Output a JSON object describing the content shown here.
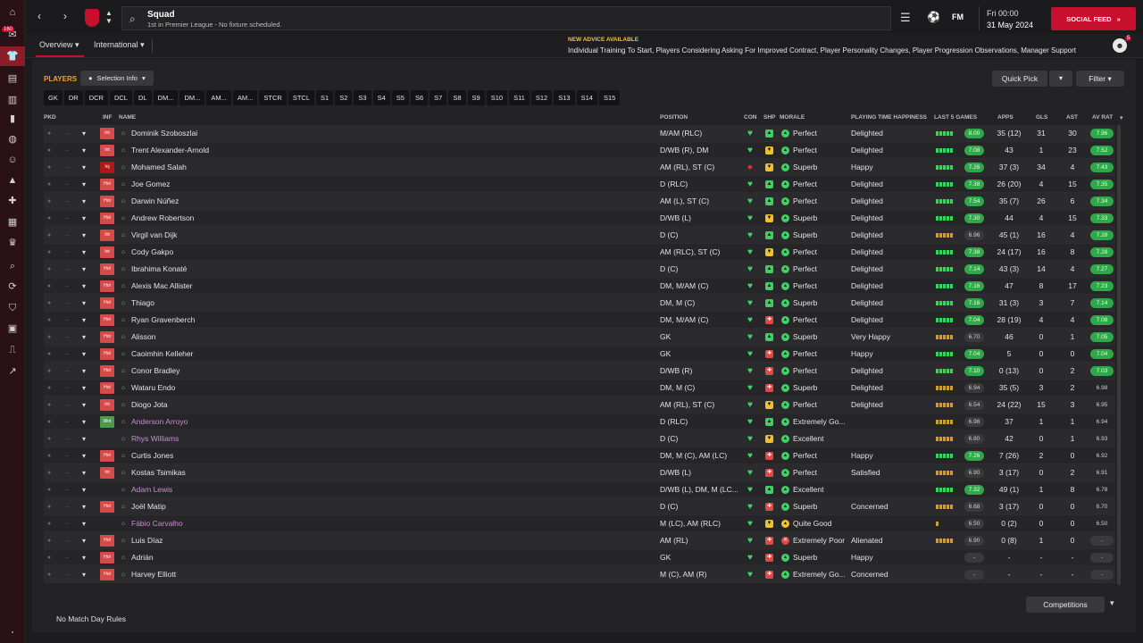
{
  "header": {
    "title": "Squad",
    "subtitle": "1st in Premier League - No fixture scheduled.",
    "logo": "FM",
    "day_time": "Fri 00:00",
    "date": "31 May 2024",
    "social_feed": "SOCIAL FEED",
    "nav_badge": "160"
  },
  "subnav": {
    "overview": "Overview",
    "international": "International",
    "advice_heading": "NEW ADVICE AVAILABLE",
    "advice_text": "Individual Training To Start, Players Considering Asking For Improved Contract, Player Personality Changes, Player Progression Observations, Manager Support",
    "advice_count": "5"
  },
  "toolbar": {
    "players_label": "PLAYERS",
    "selection_info": "Selection Info",
    "quick_pick": "Quick Pick",
    "filter": "Filter"
  },
  "position_filters": [
    "GK",
    "DR",
    "DCR",
    "DCL",
    "DL",
    "DM...",
    "DM...",
    "AM...",
    "AM...",
    "STCR",
    "STCL",
    "S1",
    "S2",
    "S3",
    "S4",
    "S5",
    "S6",
    "S7",
    "S8",
    "S9",
    "S10",
    "S11",
    "S12",
    "S13",
    "S14",
    "S15"
  ],
  "columns": {
    "pkd": "PKD",
    "inf": "INF",
    "name": "NAME",
    "position": "POSITION",
    "con": "CON",
    "shp": "SHP",
    "morale": "MORALE",
    "pth": "PLAYING TIME HAPPINESS",
    "last5": "LAST 5 GAMES",
    "apps": "APPS",
    "gls": "GLS",
    "ast": "AST",
    "avrat": "AV RAT"
  },
  "players": [
    {
      "inf": "Int",
      "name": "Dominik Szoboszlai",
      "position": "M/AM (RLC)",
      "shp": "g",
      "morale": "Perfect",
      "mor": "g",
      "pth": "Delighted",
      "bars": 5,
      "l5": "8.00",
      "apps": "35 (12)",
      "gls": "31",
      "ast": "30",
      "avr": "7.96",
      "avr_c": "g"
    },
    {
      "inf": "Int",
      "name": "Trent Alexander-Arnold",
      "position": "D/WB (R), DM",
      "shp": "y",
      "morale": "Perfect",
      "mor": "g",
      "pth": "Delighted",
      "bars": 5,
      "l5": "7.08",
      "apps": "43",
      "gls": "1",
      "ast": "23",
      "avr": "7.52",
      "avr_c": "g"
    },
    {
      "inf": "Inj",
      "name": "Mohamed Salah",
      "position": "AM (RL), ST (C)",
      "shp": "y",
      "morale": "Superb",
      "mor": "g",
      "pth": "Happy",
      "bars": 5,
      "l5": "7.26",
      "apps": "37 (3)",
      "gls": "34",
      "ast": "4",
      "avr": "7.43",
      "avr_c": "g",
      "con": "inj"
    },
    {
      "inf": "Hol",
      "name": "Joe Gomez",
      "position": "D (RLC)",
      "shp": "g",
      "morale": "Perfect",
      "mor": "g",
      "pth": "Delighted",
      "bars": 5,
      "l5": "7.38",
      "apps": "26 (20)",
      "gls": "4",
      "ast": "15",
      "avr": "7.35",
      "avr_c": "g"
    },
    {
      "inf": "Hol",
      "name": "Darwin Núñez",
      "position": "AM (L), ST (C)",
      "shp": "g",
      "morale": "Perfect",
      "mor": "g",
      "pth": "Delighted",
      "bars": 5,
      "l5": "7.54",
      "apps": "35 (7)",
      "gls": "26",
      "ast": "6",
      "avr": "7.34",
      "avr_c": "g"
    },
    {
      "inf": "Hol",
      "name": "Andrew Robertson",
      "position": "D/WB (L)",
      "shp": "y",
      "morale": "Superb",
      "mor": "g",
      "pth": "Delighted",
      "bars": 5,
      "l5": "7.30",
      "apps": "44",
      "gls": "4",
      "ast": "15",
      "avr": "7.33",
      "avr_c": "g"
    },
    {
      "inf": "Int",
      "name": "Virgil van Dijk",
      "position": "D (C)",
      "shp": "g",
      "morale": "Superb",
      "mor": "g",
      "pth": "Delighted",
      "bars": 5,
      "l5": "6.96",
      "apps": "45 (1)",
      "gls": "16",
      "ast": "4",
      "avr": "7.28",
      "avr_c": "g",
      "l5_n": true
    },
    {
      "inf": "Int",
      "name": "Cody Gakpo",
      "position": "AM (RLC), ST (C)",
      "shp": "y",
      "morale": "Perfect",
      "mor": "g",
      "pth": "Delighted",
      "bars": 5,
      "l5": "7.38",
      "apps": "24 (17)",
      "gls": "16",
      "ast": "8",
      "avr": "7.28",
      "avr_c": "g"
    },
    {
      "inf": "Hol",
      "name": "Ibrahima Konaté",
      "position": "D (C)",
      "shp": "g",
      "morale": "Perfect",
      "mor": "g",
      "pth": "Delighted",
      "bars": 5,
      "l5": "7.14",
      "apps": "43 (3)",
      "gls": "14",
      "ast": "4",
      "avr": "7.27",
      "avr_c": "g"
    },
    {
      "inf": "Hol",
      "name": "Alexis Mac Allister",
      "position": "DM, M/AM (C)",
      "shp": "g",
      "morale": "Perfect",
      "mor": "g",
      "pth": "Delighted",
      "bars": 5,
      "l5": "7.16",
      "apps": "47",
      "gls": "8",
      "ast": "17",
      "avr": "7.23",
      "avr_c": "g"
    },
    {
      "inf": "Hol",
      "name": "Thiago",
      "position": "DM, M (C)",
      "shp": "g",
      "morale": "Superb",
      "mor": "g",
      "pth": "Delighted",
      "bars": 5,
      "l5": "7.16",
      "apps": "31 (3)",
      "gls": "3",
      "ast": "7",
      "avr": "7.14",
      "avr_c": "g"
    },
    {
      "inf": "Hol",
      "name": "Ryan Gravenberch",
      "position": "DM, M/AM (C)",
      "shp": "r",
      "morale": "Perfect",
      "mor": "g",
      "pth": "Delighted",
      "bars": 5,
      "l5": "7.04",
      "apps": "28 (19)",
      "gls": "4",
      "ast": "4",
      "avr": "7.08",
      "avr_c": "g"
    },
    {
      "inf": "Hol",
      "name": "Alisson",
      "position": "GK",
      "shp": "g",
      "morale": "Superb",
      "mor": "g",
      "pth": "Very Happy",
      "bars": 5,
      "l5": "6.70",
      "apps": "46",
      "gls": "0",
      "ast": "1",
      "avr": "7.05",
      "avr_c": "g",
      "l5_n": true
    },
    {
      "inf": "Hol",
      "name": "Caoimhin Kelleher",
      "position": "GK",
      "shp": "r",
      "morale": "Perfect",
      "mor": "g",
      "pth": "Happy",
      "bars": 5,
      "l5": "7.04",
      "apps": "5",
      "gls": "0",
      "ast": "0",
      "avr": "7.04",
      "avr_c": "g"
    },
    {
      "inf": "Hol",
      "name": "Conor Bradley",
      "position": "D/WB (R)",
      "shp": "r",
      "morale": "Perfect",
      "mor": "g",
      "pth": "Delighted",
      "bars": 5,
      "l5": "7.10",
      "apps": "0 (13)",
      "gls": "0",
      "ast": "2",
      "avr": "7.03",
      "avr_c": "g"
    },
    {
      "inf": "Hol",
      "name": "Wataru Endo",
      "position": "DM, M (C)",
      "shp": "r",
      "morale": "Superb",
      "mor": "g",
      "pth": "Delighted",
      "bars": 5,
      "l5": "6.94",
      "apps": "35 (5)",
      "gls": "3",
      "ast": "2",
      "avr": "6.98",
      "avr_c": "n",
      "l5_n": true
    },
    {
      "inf": "Int",
      "name": "Diogo Jota",
      "position": "AM (RL), ST (C)",
      "shp": "y",
      "morale": "Perfect",
      "mor": "g",
      "pth": "Delighted",
      "bars": 5,
      "l5": "6.54",
      "apps": "24 (22)",
      "gls": "15",
      "ast": "3",
      "avr": "6.95",
      "avr_c": "n",
      "l5_n": true
    },
    {
      "inf": "Wnt",
      "name": "Anderson Arroyo",
      "position": "D (RLC)",
      "shp": "g",
      "morale": "Extremely Go...",
      "mor": "g",
      "pth": "",
      "bars": 5,
      "l5": "6.96",
      "apps": "37",
      "gls": "1",
      "ast": "1",
      "avr": "6.94",
      "avr_c": "n",
      "l5_n": true,
      "loan": true
    },
    {
      "inf": "",
      "name": "Rhys Williams",
      "position": "D (C)",
      "shp": "y",
      "morale": "Excellent",
      "mor": "g",
      "pth": "",
      "bars": 5,
      "l5": "6.80",
      "apps": "42",
      "gls": "0",
      "ast": "1",
      "avr": "6.93",
      "avr_c": "n",
      "l5_n": true,
      "loan": true
    },
    {
      "inf": "Hol",
      "name": "Curtis Jones",
      "position": "DM, M (C), AM (LC)",
      "shp": "r",
      "morale": "Perfect",
      "mor": "g",
      "pth": "Happy",
      "bars": 5,
      "l5": "7.26",
      "apps": "7 (26)",
      "gls": "2",
      "ast": "0",
      "avr": "6.92",
      "avr_c": "n"
    },
    {
      "inf": "Int",
      "name": "Kostas Tsimikas",
      "position": "D/WB (L)",
      "shp": "r",
      "morale": "Perfect",
      "mor": "g",
      "pth": "Satisfied",
      "bars": 5,
      "l5": "6.90",
      "apps": "3 (17)",
      "gls": "0",
      "ast": "2",
      "avr": "6.91",
      "avr_c": "n",
      "l5_n": true
    },
    {
      "inf": "",
      "name": "Adam Lewis",
      "position": "D/WB (L), DM, M (LC...",
      "shp": "g",
      "morale": "Excellent",
      "mor": "g",
      "pth": "",
      "bars": 5,
      "l5": "7.32",
      "apps": "49 (1)",
      "gls": "1",
      "ast": "8",
      "avr": "6.78",
      "avr_c": "n",
      "loan": true
    },
    {
      "inf": "Hol",
      "name": "Joël Matip",
      "position": "D (C)",
      "shp": "r",
      "morale": "Superb",
      "mor": "g",
      "pth": "Concerned",
      "bars": 5,
      "l5": "6.68",
      "apps": "3 (17)",
      "gls": "0",
      "ast": "0",
      "avr": "6.70",
      "avr_c": "n",
      "l5_n": true
    },
    {
      "inf": "",
      "name": "Fábio Carvalho",
      "position": "M (LC), AM (RLC)",
      "shp": "y",
      "morale": "Quite Good",
      "mor": "y",
      "pth": "",
      "bars": 1,
      "l5": "6.50",
      "apps": "0 (2)",
      "gls": "0",
      "ast": "0",
      "avr": "6.50",
      "avr_c": "n",
      "l5_n": true,
      "loan": true
    },
    {
      "inf": "Hol",
      "name": "Luis Díaz",
      "position": "AM (RL)",
      "shp": "r",
      "morale": "Extremely Poor",
      "mor": "r",
      "pth": "Alienated",
      "bars": 5,
      "l5": "6.90",
      "apps": "0 (8)",
      "gls": "1",
      "ast": "0",
      "avr": "-",
      "avr_c": "none",
      "l5_n": true
    },
    {
      "inf": "Hol",
      "name": "Adrián",
      "position": "GK",
      "shp": "r",
      "morale": "Superb",
      "mor": "g",
      "pth": "Happy",
      "bars": 0,
      "l5": "-",
      "apps": "-",
      "gls": "-",
      "ast": "-",
      "avr": "-",
      "avr_c": "none",
      "l5_n": true
    },
    {
      "inf": "Hol",
      "name": "Harvey Elliott",
      "position": "M (C), AM (R)",
      "shp": "r",
      "morale": "Extremely Go...",
      "mor": "g",
      "pth": "Concerned",
      "bars": 0,
      "l5": "-",
      "apps": "-",
      "gls": "-",
      "ast": "-",
      "avr": "-",
      "avr_c": "none",
      "l5_n": true
    }
  ],
  "footer": {
    "rules": "No Match Day Rules",
    "competitions": "Competitions"
  }
}
